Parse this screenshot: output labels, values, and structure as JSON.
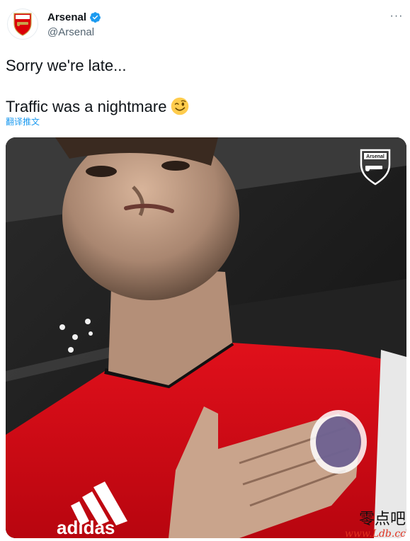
{
  "tweet": {
    "display_name": "Arsenal",
    "handle": "@Arsenal",
    "text_line1": "Sorry we're late...",
    "text_line2": "Traffic was a nightmare",
    "translate_label": "翻译推文",
    "more_label": "···"
  },
  "media": {
    "crest_text": "Arsenal",
    "shirt_brand": "adidas"
  },
  "watermark": {
    "cn": "零点吧",
    "url": "www.Ldb.cc"
  },
  "colors": {
    "verified": "#1d9bf0",
    "link": "#1d9bf0",
    "arsenal_red": "#db0007"
  },
  "icons": {
    "verified": "verified-badge-icon",
    "more": "more-horizontal-icon",
    "emoji": "winking-face-emoji"
  }
}
